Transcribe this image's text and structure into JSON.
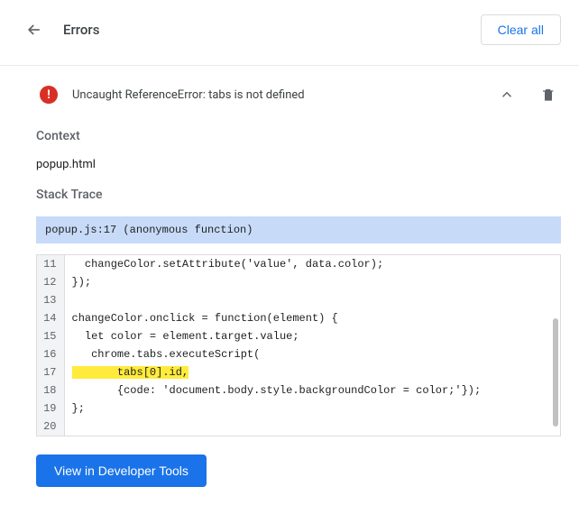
{
  "header": {
    "title": "Errors",
    "clear_all": "Clear all"
  },
  "error": {
    "message": "Uncaught ReferenceError: tabs is not defined",
    "context_label": "Context",
    "context_value": "popup.html",
    "stack_trace_label": "Stack Trace",
    "stack_location": "popup.js:17 (anonymous function)",
    "highlighted_line": 17,
    "code": [
      {
        "n": 11,
        "t": "  changeColor.setAttribute('value', data.color);"
      },
      {
        "n": 12,
        "t": "});"
      },
      {
        "n": 13,
        "t": ""
      },
      {
        "n": 14,
        "t": "changeColor.onclick = function(element) {"
      },
      {
        "n": 15,
        "t": "  let color = element.target.value;"
      },
      {
        "n": 16,
        "t": "   chrome.tabs.executeScript("
      },
      {
        "n": 17,
        "t": "       tabs[0].id,"
      },
      {
        "n": 18,
        "t": "       {code: 'document.body.style.backgroundColor = color;'});"
      },
      {
        "n": 19,
        "t": "};"
      },
      {
        "n": 20,
        "t": ""
      }
    ]
  },
  "footer": {
    "view_devtools": "View in Developer Tools"
  }
}
